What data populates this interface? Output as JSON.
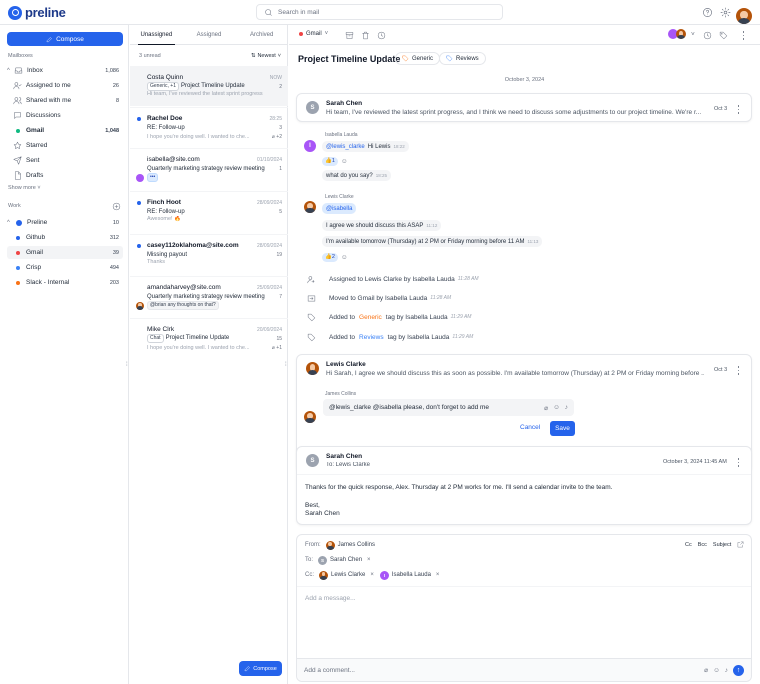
{
  "app": {
    "brand": "preline"
  },
  "search": {
    "placeholder": "Search in mail"
  },
  "sidebar": {
    "compose_label": "Compose",
    "mailboxes_label": "Mailboxes",
    "inbox": {
      "label": "Inbox",
      "count": "1,086"
    },
    "inbox_items": [
      {
        "label": "Assigned to me",
        "count": "26"
      },
      {
        "label": "Shared with me",
        "count": "8"
      },
      {
        "label": "Discussions",
        "count": ""
      }
    ],
    "gmail": {
      "label": "Gmail",
      "count": "1,048"
    },
    "others": [
      {
        "label": "Starred"
      },
      {
        "label": "Sent"
      },
      {
        "label": "Drafts"
      }
    ],
    "show_more": "Show more",
    "work_label": "Work",
    "preline": {
      "label": "Preline",
      "count": "10"
    },
    "work_items": [
      {
        "label": "Github",
        "count": "312",
        "color": "#2563eb"
      },
      {
        "label": "Gmail",
        "count": "39",
        "color": "#ef4444"
      },
      {
        "label": "Crisp",
        "count": "494",
        "color": "#3b82f6"
      },
      {
        "label": "Slack - Internal",
        "count": "203",
        "color": "#f97316"
      }
    ]
  },
  "list": {
    "tabs": [
      "Unassigned",
      "Assigned",
      "Archived"
    ],
    "unread": "3 unread",
    "sort": "Newest",
    "compose_label": "Compose",
    "mails": [
      {
        "from": "Costa Quinn",
        "date": "NOW",
        "chip1": "Generic, +1",
        "subject": "Project Timeline Update",
        "count": "2",
        "preview": "Hi team, I've reviewed the latest sprint progress"
      },
      {
        "from": "Rachel Doe",
        "date": "28:25",
        "subject": "RE: Follow-up",
        "count": "3",
        "preview": "I hope you're doing well. I wanted to che...",
        "attach": "+2"
      },
      {
        "from": "isabella@site.com",
        "date": "01/10/2024",
        "subject": "Quarterly marketing strategy review meeting",
        "count": "1",
        "extra": "•••"
      },
      {
        "from": "Finch Hoot",
        "date": "28/09/2024",
        "subject": "RE: Follow-up",
        "count": "5",
        "preview": "Awesome! 🔥"
      },
      {
        "from": "casey112oklahoma@site.com",
        "date": "28/09/2024",
        "subject": "Missing payout",
        "count": "19",
        "preview": "Thanks"
      },
      {
        "from": "amandaharvey@site.com",
        "date": "25/09/2024",
        "subject": "Quarterly marketing strategy review meeting",
        "count": "7",
        "extra": "@brian any thoughts on that?"
      },
      {
        "from": "Mike Clrk",
        "date": "20/09/2024",
        "chip1": "Chat",
        "subject": "Project Timeline Update",
        "count": "15",
        "preview": "I hope you're doing well. I wanted to che...",
        "attach": "+1"
      }
    ]
  },
  "toolbar": {
    "mailbox": "Gmail"
  },
  "thread": {
    "title": "Project Timeline Update",
    "tags": [
      "Generic",
      "Reviews"
    ],
    "date_sep": "October 3, 2024",
    "msg1": {
      "initial": "S",
      "name": "Sarah Chen",
      "snippet": "Hi team, I've reviewed the latest sprint progress, and I think we need to discuss some adjustments to our project timeline. We're r...",
      "date": "Oct 3"
    },
    "comments": {
      "isabella_name": "Isabella Lauda",
      "isabella_initial": "I",
      "b1_mention": "@lewis_clarke",
      "b1_text": "Hi Lewis",
      "b1_time": "18:22",
      "r1_count": "1",
      "b2_text": "what do you say?",
      "b2_time": "18:25",
      "lewis_name": "Lewis Clarke",
      "b3_mention": "@isabella",
      "b4_text": "I agree we should discuss this ASAP",
      "b4_time": "11:12",
      "b5_text": "I'm available tomorrow (Thursday) at 2 PM or Friday morning before 11 AM",
      "b5_time": "11:13",
      "r2_count": "2"
    },
    "activity": [
      {
        "text": "Assigned to Lewis Clarke by Isabella Lauda",
        "time": "11:28 AM"
      },
      {
        "text": "Moved to Gmail by Isabella Lauda",
        "time": "11:28 AM"
      },
      {
        "pre": "Added to",
        "tag": "Generic",
        "post": "tag by Isabella Lauda",
        "time": "11:29 AM",
        "color": "#f97316"
      },
      {
        "pre": "Added to",
        "tag": "Reviews",
        "post": "tag by Isabella Lauda",
        "time": "11:29 AM",
        "color": "#3b82f6"
      }
    ],
    "msg2": {
      "name": "Lewis Clarke",
      "snippet": "Hi Sarah, I agree we should discuss this as soon as possible. I'm available tomorrow (Thursday) at 2 PM or Friday morning before ...",
      "date": "Oct 3"
    },
    "reply": {
      "author": "James Collins",
      "text": "@lewis_clarke @isabella please, don't forget to add me",
      "cancel": "Cancel",
      "save": "Save"
    },
    "msg3": {
      "initial": "S",
      "name": "Sarah Chen",
      "to": "To: Lewis Clarke",
      "date": "October 3, 2024 11:45 AM",
      "body1": "Thanks for the quick response, Alex. Thursday at 2 PM works for me. I'll send a calendar invite to the team.",
      "body2": "Best,",
      "body3": "Sarah Chen"
    },
    "composer": {
      "from_label": "From:",
      "from_name": "James Collins",
      "to_label": "To:",
      "to_name": "Sarah Chen",
      "to_initial": "S",
      "cc_label": "Cc:",
      "cc1": "Lewis Clarke",
      "cc2": "Isabella Lauda",
      "cc2_initial": "I",
      "cc_btn": "Cc",
      "bcc_btn": "Bcc",
      "subject_btn": "Subject",
      "placeholder": "Add a message...",
      "comment_placeholder": "Add a comment..."
    }
  }
}
